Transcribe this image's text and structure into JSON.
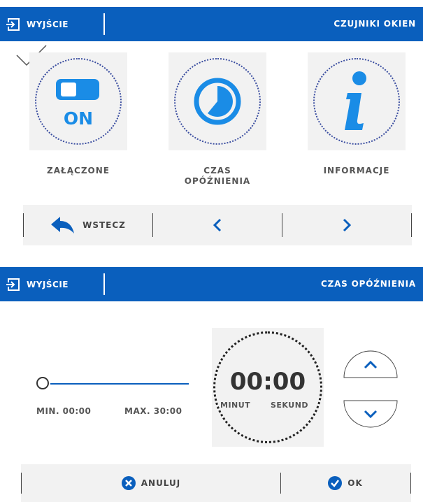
{
  "colors": {
    "header_bg": "#0a5fbd",
    "accent": "#1a8ce6",
    "panel": "#f2f2f2"
  },
  "screen1": {
    "header": {
      "exit_label": "WYJŚCIE",
      "title": "CZUJNIKI OKIEN"
    },
    "tiles": [
      {
        "label": "ZAŁĄCZONE",
        "icon": "toggle-on-icon",
        "toggle_text": "ON"
      },
      {
        "label_line1": "CZAS",
        "label_line2": "OPÓŹNIENIA",
        "icon": "clock-icon"
      },
      {
        "label": "INFORMACJE",
        "icon": "info-icon"
      }
    ],
    "nav": {
      "back_label": "WSTECZ",
      "prev_icon": "chevron-left-icon",
      "next_icon": "chevron-right-icon"
    }
  },
  "screen2": {
    "header": {
      "exit_label": "WYJŚCIE",
      "title": "CZAS OPÓŹNIENIA"
    },
    "slider": {
      "min_label": "MIN. 00:00",
      "max_label": "MAX. 30:00",
      "value_fraction": 0
    },
    "timer": {
      "value": "00:00",
      "unit_minutes": "MINUT",
      "unit_seconds": "SEKUND"
    },
    "actions": {
      "cancel_label": "ANULUJ",
      "ok_label": "OK"
    }
  }
}
